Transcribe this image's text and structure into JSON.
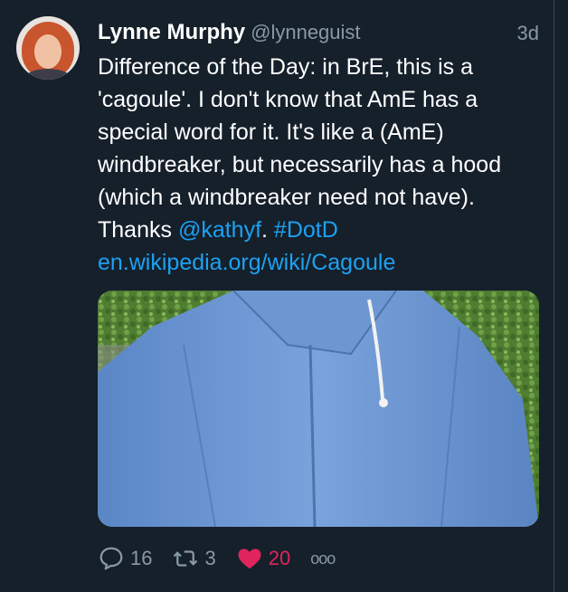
{
  "tweet": {
    "author_name": "Lynne Murphy",
    "author_handle": "@lynneguist",
    "timestamp": "3d",
    "text_main": "Difference of the Day: in BrE, this is a 'cagoule'. I don't know that AmE has a special word for it. It's like a (AmE) windbreaker, but necessarily has a hood (which a windbreaker need not have). Thanks ",
    "mention": "@kathyf",
    "after_mention": ". ",
    "hashtag": "#DotD",
    "url": "en.wikipedia.org/wiki/Cagoule"
  },
  "actions": {
    "reply_count": "16",
    "retweet_count": "3",
    "like_count": "20",
    "more_label": "ooo"
  },
  "colors": {
    "background": "#15202b",
    "text": "#ffffff",
    "secondary": "#8899a6",
    "link": "#1da1f2",
    "like": "#e0245e"
  },
  "icons": [
    "reply-icon",
    "retweet-icon",
    "heart-icon",
    "more-icon"
  ]
}
